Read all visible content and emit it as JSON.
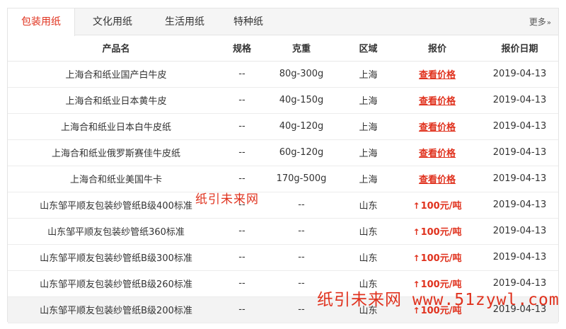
{
  "tabs": [
    {
      "label": "包装用纸",
      "active": true
    },
    {
      "label": "文化用纸",
      "active": false
    },
    {
      "label": "生活用纸",
      "active": false
    },
    {
      "label": "特种纸",
      "active": false
    }
  ],
  "more_label": "更多",
  "more_icon": "chevron-double-right-icon",
  "columns": [
    "产品名",
    "规格",
    "克重",
    "区域",
    "报价",
    "报价日期"
  ],
  "rows": [
    {
      "name": "上海合和纸业国产白牛皮",
      "spec": "--",
      "weight": "80g-300g",
      "region": "上海",
      "price": "查看价格",
      "price_type": "link",
      "date": "2019-04-13"
    },
    {
      "name": "上海合和纸业日本黄牛皮",
      "spec": "--",
      "weight": "40g-150g",
      "region": "上海",
      "price": "查看价格",
      "price_type": "link",
      "date": "2019-04-13"
    },
    {
      "name": "上海合和纸业日本白牛皮纸",
      "spec": "--",
      "weight": "40g-120g",
      "region": "上海",
      "price": "查看价格",
      "price_type": "link",
      "date": "2019-04-13"
    },
    {
      "name": "上海合和纸业俄罗斯赛佳牛皮纸",
      "spec": "--",
      "weight": "60g-120g",
      "region": "上海",
      "price": "查看价格",
      "price_type": "link",
      "date": "2019-04-13"
    },
    {
      "name": "上海合和纸业美国牛卡",
      "spec": "--",
      "weight": "170g-500g",
      "region": "上海",
      "price": "查看价格",
      "price_type": "link",
      "date": "2019-04-13"
    },
    {
      "name": "山东邹平顺友包装纱管纸B级400标准",
      "spec": "--",
      "weight": "--",
      "region": "山东",
      "price": "100元/吨",
      "price_type": "up",
      "date": "2019-04-13"
    },
    {
      "name": "山东邹平顺友包装纱管纸360标准",
      "spec": "--",
      "weight": "--",
      "region": "山东",
      "price": "100元/吨",
      "price_type": "up",
      "date": "2019-04-13"
    },
    {
      "name": "山东邹平顺友包装纱管纸B级300标准",
      "spec": "--",
      "weight": "--",
      "region": "山东",
      "price": "100元/吨",
      "price_type": "up",
      "date": "2019-04-13"
    },
    {
      "name": "山东邹平顺友包装纱管纸B级260标准",
      "spec": "--",
      "weight": "--",
      "region": "山东",
      "price": "100元/吨",
      "price_type": "up",
      "date": "2019-04-13"
    },
    {
      "name": "山东邹平顺友包装纱管纸B级200标准",
      "spec": "--",
      "weight": "--",
      "region": "山东",
      "price": "100元/吨",
      "price_type": "up",
      "date": "2019-04-13",
      "shaded": true
    }
  ],
  "watermarks": [
    "纸引未来网",
    "纸引未来网 www.51zywl.com"
  ],
  "colors": {
    "accent": "#e0321e",
    "border": "#e4e4e4",
    "tabbar_bg": "#f5f5f5"
  }
}
